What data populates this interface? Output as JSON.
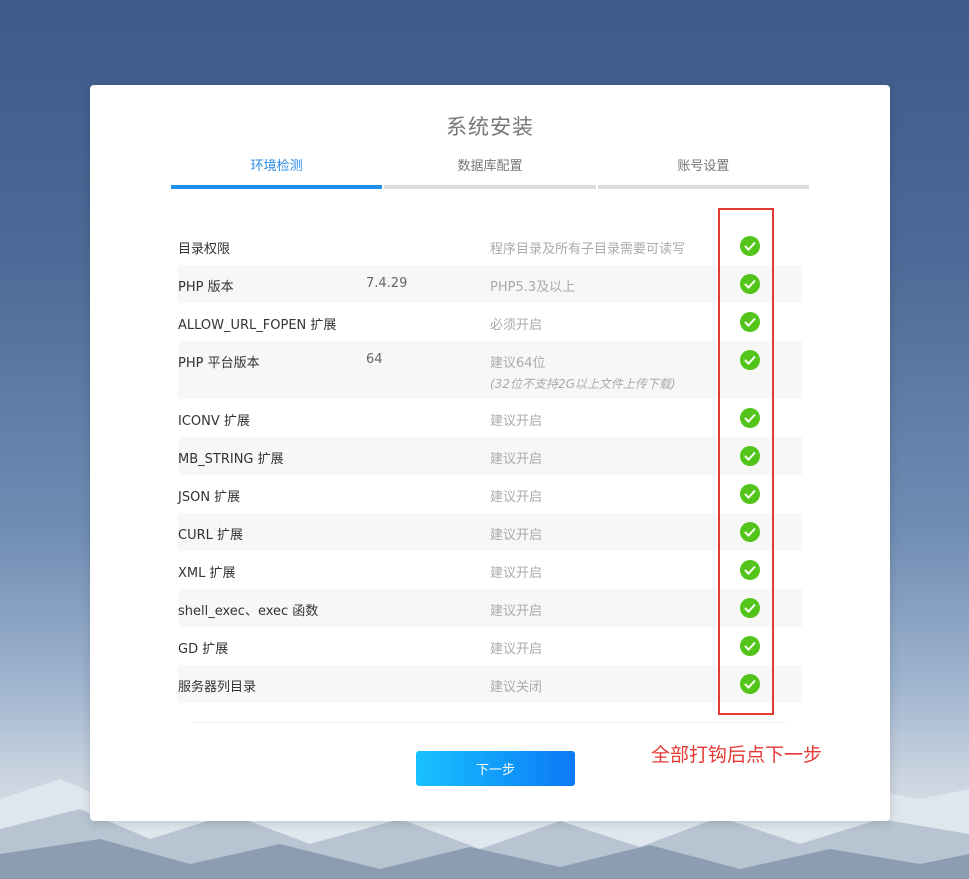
{
  "title": "系统安装",
  "steps": [
    {
      "label": "环境检测"
    },
    {
      "label": "数据库配置"
    },
    {
      "label": "账号设置"
    }
  ],
  "checks": [
    {
      "name": "目录权限",
      "value": "",
      "requirement": "程序目录及所有子目录需要可读写",
      "note": ""
    },
    {
      "name": "PHP 版本",
      "value": "7.4.29",
      "requirement": "PHP5.3及以上",
      "note": ""
    },
    {
      "name": "ALLOW_URL_FOPEN 扩展",
      "value": "",
      "requirement": "必须开启",
      "note": ""
    },
    {
      "name": "PHP 平台版本",
      "value": "64",
      "requirement": "建议64位",
      "note": "(32位不支持2G以上文件上传下载)"
    },
    {
      "name": "ICONV 扩展",
      "value": "",
      "requirement": "建议开启",
      "note": ""
    },
    {
      "name": "MB_STRING 扩展",
      "value": "",
      "requirement": "建议开启",
      "note": ""
    },
    {
      "name": "JSON 扩展",
      "value": "",
      "requirement": "建议开启",
      "note": ""
    },
    {
      "name": "CURL 扩展",
      "value": "",
      "requirement": "建议开启",
      "note": ""
    },
    {
      "name": "XML 扩展",
      "value": "",
      "requirement": "建议开启",
      "note": ""
    },
    {
      "name": "shell_exec、exec 函数",
      "value": "",
      "requirement": "建议开启",
      "note": ""
    },
    {
      "name": "GD 扩展",
      "value": "",
      "requirement": "建议开启",
      "note": ""
    },
    {
      "name": "服务器列目录",
      "value": "",
      "requirement": "建议关闭",
      "note": ""
    }
  ],
  "next_button": "下一步",
  "annotation": "全部打钩后点下一步",
  "colors": {
    "accent": "#1e90ee",
    "check": "#52c41a",
    "annotation": "#e53935"
  },
  "status_icon": "check-circle-icon"
}
